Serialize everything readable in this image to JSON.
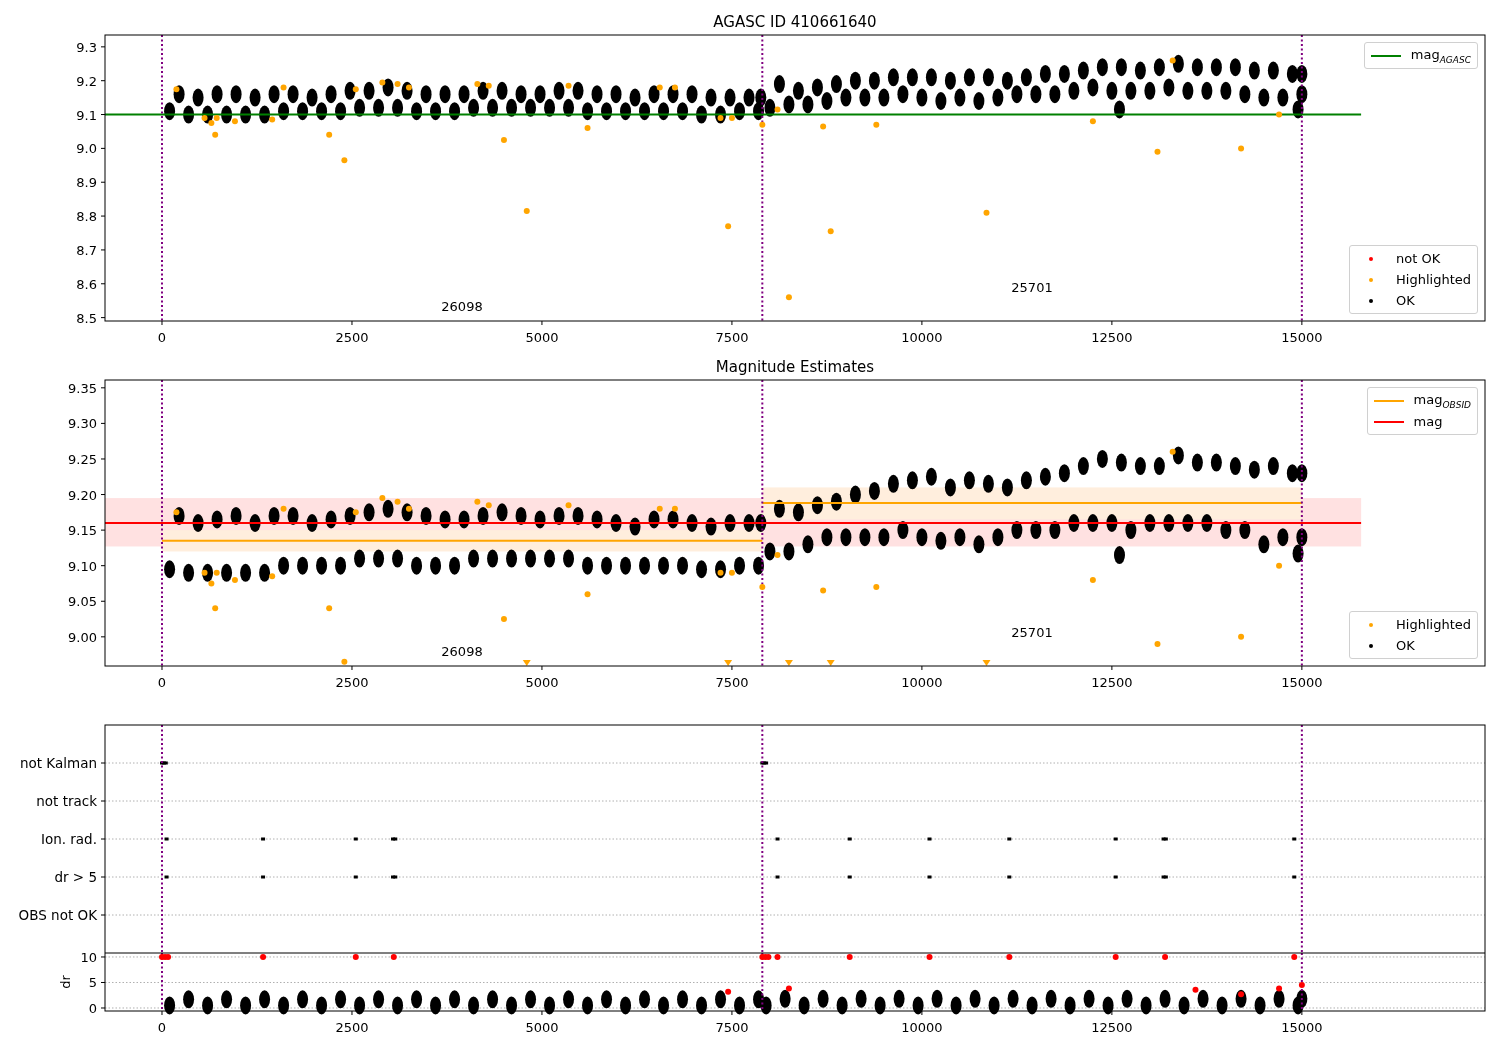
{
  "panels": [
    {
      "kind": "main",
      "legends": [
        {
          "items": [
            {
              "label": "mag$_{AGASC}$",
              "kind": "line",
              "color": "#008000"
            }
          ]
        },
        {
          "items": [
            {
              "label": "not OK",
              "kind": "marker",
              "color": "#ff0000"
            },
            {
              "label": "Highlighted",
              "kind": "marker",
              "color": "#ffa500"
            },
            {
              "label": "OK",
              "kind": "marker",
              "color": "#000000"
            }
          ]
        }
      ],
      "chart_data": {
        "type": "scatter",
        "title": "AGASC ID 410661640",
        "xlim": [
          -750,
          17410
        ],
        "ylim": [
          8.49,
          9.335
        ],
        "xticks": [
          0,
          2500,
          5000,
          7500,
          10000,
          12500,
          15000
        ],
        "yticks": [
          {
            "value": 8.5,
            "label": "8.5"
          },
          {
            "value": 8.6,
            "label": "8.6"
          },
          {
            "value": 8.7,
            "label": "8.7"
          },
          {
            "value": 8.8,
            "label": "8.8"
          },
          {
            "value": 8.9,
            "label": "8.9"
          },
          {
            "value": 9.0,
            "label": "9.0"
          },
          {
            "value": 9.1,
            "label": "9.1"
          },
          {
            "value": 9.2,
            "label": "9.2"
          },
          {
            "value": 9.3,
            "label": "9.3"
          }
        ],
        "series": [
          {
            "color": "#000000",
            "x": [
              100,
              225,
              350,
              475,
              600,
              725,
              850,
              975,
              1100,
              1225,
              1350,
              1475,
              1600,
              1725,
              1850,
              1975,
              2100,
              2225,
              2350,
              2475,
              2600,
              2725,
              2850,
              2975,
              3100,
              3225,
              3350,
              3475,
              3600,
              3725,
              3850,
              3975,
              4100,
              4225,
              4350,
              4475,
              4600,
              4725,
              4850,
              4975,
              5100,
              5225,
              5350,
              5475,
              5600,
              5725,
              5850,
              5975,
              6100,
              6225,
              6350,
              6475,
              6600,
              6725,
              6850,
              6975,
              7100,
              7225,
              7350,
              7475,
              7600,
              7725,
              7850,
              7880,
              8000,
              8125,
              8250,
              8375,
              8500,
              8625,
              8750,
              8875,
              9000,
              9125,
              9250,
              9375,
              9500,
              9625,
              9750,
              9875,
              10000,
              10125,
              10250,
              10375,
              10500,
              10625,
              10750,
              10875,
              11000,
              11125,
              11250,
              11375,
              11500,
              11625,
              11750,
              11875,
              12000,
              12125,
              12250,
              12375,
              12500,
              12625,
              12750,
              12875,
              13000,
              13125,
              13250,
              13375,
              13500,
              13625,
              13750,
              13875,
              14000,
              14125,
              14250,
              14375,
              14500,
              14625,
              14750,
              14875,
              15000,
              15000,
              12600,
              14950
            ],
            "values": [
              9.11,
              9.16,
              9.1,
              9.15,
              9.1,
              9.16,
              9.1,
              9.16,
              9.1,
              9.15,
              9.1,
              9.16,
              9.11,
              9.16,
              9.11,
              9.15,
              9.11,
              9.16,
              9.11,
              9.17,
              9.12,
              9.17,
              9.12,
              9.18,
              9.12,
              9.17,
              9.11,
              9.16,
              9.11,
              9.16,
              9.11,
              9.16,
              9.12,
              9.17,
              9.12,
              9.17,
              9.12,
              9.16,
              9.12,
              9.16,
              9.12,
              9.17,
              9.12,
              9.17,
              9.11,
              9.16,
              9.11,
              9.16,
              9.11,
              9.15,
              9.11,
              9.16,
              9.11,
              9.16,
              9.11,
              9.16,
              9.1,
              9.15,
              9.1,
              9.15,
              9.11,
              9.15,
              9.11,
              9.15,
              9.12,
              9.19,
              9.13,
              9.17,
              9.13,
              9.18,
              9.14,
              9.19,
              9.15,
              9.2,
              9.15,
              9.2,
              9.15,
              9.21,
              9.16,
              9.21,
              9.15,
              9.21,
              9.14,
              9.2,
              9.15,
              9.21,
              9.14,
              9.21,
              9.15,
              9.2,
              9.16,
              9.21,
              9.16,
              9.22,
              9.16,
              9.22,
              9.17,
              9.23,
              9.18,
              9.24,
              9.17,
              9.24,
              9.17,
              9.23,
              9.17,
              9.24,
              9.18,
              9.25,
              9.17,
              9.24,
              9.17,
              9.24,
              9.17,
              9.24,
              9.16,
              9.23,
              9.15,
              9.23,
              9.15,
              9.22,
              9.16,
              9.22,
              9.115,
              9.115
            ]
          },
          {
            "color": "#ffa500",
            "x": [
              190,
              560,
              650,
              700,
              720,
              960,
              1450,
              1600,
              2200,
              2400,
              2550,
              2900,
              3100,
              3250,
              4150,
              4300,
              4500,
              4800,
              5350,
              5600,
              6550,
              6750,
              7350,
              7450,
              7500,
              7900,
              8100,
              8250,
              8700,
              8800,
              9400,
              10850,
              12250,
              13100,
              13300,
              14200,
              14700
            ],
            "values": [
              9.175,
              9.09,
              9.075,
              9.04,
              9.09,
              9.08,
              9.085,
              9.18,
              9.04,
              8.965,
              9.175,
              9.195,
              9.19,
              9.18,
              9.19,
              9.185,
              9.025,
              8.815,
              9.185,
              9.06,
              9.18,
              9.18,
              9.09,
              8.77,
              9.09,
              9.07,
              9.115,
              8.56,
              9.065,
              8.755,
              9.07,
              8.81,
              9.08,
              8.99,
              9.26,
              9.0,
              9.1
            ]
          },
          {
            "type": "line",
            "color": "#008000",
            "x": [
              -750,
              15780
            ],
            "values": [
              9.1,
              9.1
            ]
          }
        ],
        "ref_lines": [
          {
            "axis": "x",
            "value": 0,
            "color": "#800080"
          },
          {
            "axis": "x",
            "value": 7900,
            "color": "#800080"
          },
          {
            "axis": "x",
            "value": 15000,
            "color": "#800080"
          }
        ],
        "annotations": [
          "26098",
          "25701"
        ]
      }
    },
    {
      "kind": "main",
      "legends": [
        {
          "items": [
            {
              "label": "mag$_{OBSID}$",
              "kind": "line",
              "color": "#ffa500"
            },
            {
              "label": "mag",
              "kind": "line",
              "color": "#ff0000"
            }
          ]
        },
        {
          "items": [
            {
              "label": "Highlighted",
              "kind": "marker",
              "color": "#ffa500"
            },
            {
              "label": "OK",
              "kind": "marker",
              "color": "#000000"
            }
          ]
        }
      ],
      "chart_data": {
        "type": "scatter",
        "title": "Magnitude Estimates",
        "xlim": [
          -750,
          17410
        ],
        "ylim": [
          8.959,
          9.361
        ],
        "xticks": [
          0,
          2500,
          5000,
          7500,
          10000,
          12500,
          15000
        ],
        "yticks": [
          {
            "value": 9.0,
            "label": "9.00"
          },
          {
            "value": 9.05,
            "label": "9.05"
          },
          {
            "value": 9.1,
            "label": "9.10"
          },
          {
            "value": 9.15,
            "label": "9.15"
          },
          {
            "value": 9.2,
            "label": "9.20"
          },
          {
            "value": 9.25,
            "label": "9.25"
          },
          {
            "value": 9.3,
            "label": "9.30"
          },
          {
            "value": 9.35,
            "label": "9.35"
          }
        ],
        "bands": [
          {
            "axis": "y",
            "from": 9.127,
            "to": 9.195,
            "color": "#ffe1e1"
          },
          {
            "axis": "y",
            "from": 9.12,
            "to": 9.15,
            "color": "#ffeedd"
          },
          {
            "axis": "y",
            "from": 9.165,
            "to": 9.21,
            "color": "#ffeedd"
          }
        ],
        "series": [
          {
            "color": "#000000",
            "x": [
              100,
              225,
              350,
              475,
              600,
              725,
              850,
              975,
              1100,
              1225,
              1350,
              1475,
              1600,
              1725,
              1850,
              1975,
              2100,
              2225,
              2350,
              2475,
              2600,
              2725,
              2850,
              2975,
              3100,
              3225,
              3350,
              3475,
              3600,
              3725,
              3850,
              3975,
              4100,
              4225,
              4350,
              4475,
              4600,
              4725,
              4850,
              4975,
              5100,
              5225,
              5350,
              5475,
              5600,
              5725,
              5850,
              5975,
              6100,
              6225,
              6350,
              6475,
              6600,
              6725,
              6850,
              6975,
              7100,
              7225,
              7350,
              7475,
              7600,
              7725,
              7850,
              7880,
              8000,
              8125,
              8250,
              8375,
              8500,
              8625,
              8750,
              8875,
              9000,
              9125,
              9250,
              9375,
              9500,
              9625,
              9750,
              9875,
              10000,
              10125,
              10250,
              10375,
              10500,
              10625,
              10750,
              10875,
              11000,
              11125,
              11250,
              11375,
              11500,
              11625,
              11750,
              11875,
              12000,
              12125,
              12250,
              12375,
              12500,
              12625,
              12750,
              12875,
              13000,
              13125,
              13250,
              13375,
              13500,
              13625,
              13750,
              13875,
              14000,
              14125,
              14250,
              14375,
              14500,
              14625,
              14750,
              14875,
              15000,
              15000,
              12600,
              14950
            ],
            "values": [
              9.095,
              9.17,
              9.09,
              9.16,
              9.09,
              9.165,
              9.09,
              9.17,
              9.09,
              9.16,
              9.09,
              9.17,
              9.1,
              9.17,
              9.1,
              9.16,
              9.1,
              9.165,
              9.1,
              9.17,
              9.11,
              9.175,
              9.11,
              9.18,
              9.11,
              9.175,
              9.1,
              9.17,
              9.1,
              9.165,
              9.1,
              9.165,
              9.11,
              9.17,
              9.11,
              9.175,
              9.11,
              9.17,
              9.11,
              9.165,
              9.11,
              9.17,
              9.11,
              9.17,
              9.1,
              9.165,
              9.1,
              9.16,
              9.1,
              9.155,
              9.1,
              9.165,
              9.1,
              9.165,
              9.1,
              9.16,
              9.095,
              9.155,
              9.095,
              9.16,
              9.1,
              9.16,
              9.1,
              9.16,
              9.12,
              9.18,
              9.12,
              9.175,
              9.13,
              9.185,
              9.14,
              9.19,
              9.14,
              9.2,
              9.14,
              9.205,
              9.14,
              9.215,
              9.15,
              9.22,
              9.14,
              9.225,
              9.135,
              9.21,
              9.14,
              9.22,
              9.13,
              9.215,
              9.14,
              9.21,
              9.15,
              9.22,
              9.15,
              9.225,
              9.15,
              9.23,
              9.16,
              9.24,
              9.16,
              9.25,
              9.16,
              9.245,
              9.15,
              9.24,
              9.16,
              9.24,
              9.16,
              9.255,
              9.16,
              9.245,
              9.16,
              9.245,
              9.15,
              9.24,
              9.15,
              9.235,
              9.13,
              9.24,
              9.14,
              9.23,
              9.14,
              9.23,
              9.115,
              9.117
            ]
          },
          {
            "color": "#ffa500",
            "x": [
              190,
              560,
              650,
              700,
              720,
              960,
              1450,
              1600,
              2200,
              2400,
              2550,
              2900,
              3100,
              3250,
              4150,
              4300,
              4500,
              4800,
              5350,
              5600,
              6550,
              6750,
              7350,
              7450,
              7500,
              7900,
              8100,
              8250,
              8700,
              8800,
              9400,
              10850,
              12250,
              13100,
              13300,
              14200,
              14700
            ],
            "values": [
              9.175,
              9.09,
              9.075,
              9.04,
              9.09,
              9.08,
              9.085,
              9.18,
              9.04,
              8.965,
              9.175,
              9.195,
              9.19,
              9.18,
              9.19,
              9.185,
              9.025,
              null,
              9.185,
              9.06,
              9.18,
              9.18,
              9.09,
              null,
              9.09,
              9.07,
              9.115,
              null,
              9.065,
              null,
              9.07,
              null,
              9.08,
              8.99,
              9.26,
              9.0,
              9.1
            ]
          },
          {
            "color": "#ffa500",
            "x": [
              4800,
              7450,
              8250,
              8800,
              10850
            ],
            "values": [
              8.963,
              8.963,
              8.963,
              8.963,
              8.963
            ]
          },
          {
            "type": "line",
            "color": "#ff0000",
            "x": [
              -750,
              15780
            ],
            "values": [
              9.16,
              9.16
            ]
          },
          {
            "type": "line",
            "color": "#ffa500",
            "x": [
              0,
              7900
            ],
            "values": [
              9.135,
              9.135
            ]
          },
          {
            "type": "line",
            "color": "#ffa500",
            "x": [
              7900,
              15000
            ],
            "values": [
              9.188,
              9.188
            ]
          }
        ],
        "ref_lines": [
          {
            "axis": "x",
            "value": 0,
            "color": "#800080"
          },
          {
            "axis": "x",
            "value": 7900,
            "color": "#800080"
          },
          {
            "axis": "x",
            "value": 15000,
            "color": "#800080"
          }
        ],
        "annotations": [
          "26098",
          "25701"
        ]
      }
    },
    {
      "kind": "flags",
      "rows": [
        "not Kalman",
        "not track",
        "Ion. rad.",
        "dr > 5",
        "OBS not OK"
      ]
    },
    {
      "kind": "dr",
      "chart_data": {
        "type": "scatter",
        "ylabel": "dr",
        "grid": true,
        "xlim": [
          -750,
          17410
        ],
        "ylim": [
          -0.59,
          10.78
        ],
        "xticks": [
          0,
          2500,
          5000,
          7500,
          10000,
          12500,
          15000
        ],
        "yticks": [
          {
            "value": 0,
            "label": "0"
          },
          {
            "value": 5,
            "label": "5"
          },
          {
            "value": 10,
            "label": "10"
          }
        ],
        "series": [
          {
            "color": "#000000",
            "x": [
              100,
              350,
              600,
              850,
              1100,
              1350,
              1600,
              1850,
              2100,
              2350,
              2600,
              2850,
              3100,
              3350,
              3600,
              3850,
              4100,
              4350,
              4600,
              4850,
              5100,
              5350,
              5600,
              5850,
              6100,
              6350,
              6600,
              6850,
              7100,
              7350,
              7600,
              7850,
              7950,
              8200,
              8450,
              8700,
              8950,
              9200,
              9450,
              9700,
              9950,
              10200,
              10450,
              10700,
              10950,
              11200,
              11450,
              11700,
              11950,
              12200,
              12450,
              12700,
              12950,
              13200,
              13450,
              13700,
              13950,
              14200,
              14450,
              14700,
              14950,
              15000
            ],
            "values": [
              0.5,
              1.7,
              0.5,
              1.7,
              0.5,
              1.7,
              0.5,
              1.7,
              0.5,
              1.7,
              0.5,
              1.7,
              0.5,
              1.7,
              0.5,
              1.7,
              0.5,
              1.7,
              0.5,
              1.7,
              0.5,
              1.7,
              0.5,
              1.7,
              0.5,
              1.7,
              0.5,
              1.7,
              0.5,
              1.7,
              0.5,
              1.7,
              0.5,
              1.8,
              0.5,
              1.8,
              0.5,
              1.8,
              0.5,
              1.8,
              0.5,
              1.8,
              0.5,
              1.8,
              0.5,
              1.8,
              0.5,
              1.8,
              0.5,
              1.8,
              0.5,
              1.8,
              0.5,
              1.8,
              0.5,
              1.8,
              0.5,
              1.8,
              0.5,
              1.8,
              0.5,
              1.8
            ]
          },
          {
            "color": "#ff0000",
            "x": [
              0,
              40,
              80,
              1330,
              2550,
              3050,
              7450,
              7900,
              7940,
              7980,
              8100,
              8250,
              9050,
              10100,
              11150,
              12550,
              13200,
              13600,
              14200,
              14700,
              14900,
              15000
            ],
            "values": [
              10,
              10,
              10,
              10,
              10,
              10,
              3.2,
              10,
              10,
              10,
              10,
              3.8,
              10,
              10,
              10,
              10,
              10,
              3.6,
              2.7,
              3.8,
              10,
              4.5
            ]
          }
        ],
        "ref_lines": [
          {
            "axis": "x",
            "value": 0,
            "color": "#800080"
          },
          {
            "axis": "x",
            "value": 7900,
            "color": "#800080"
          },
          {
            "axis": "x",
            "value": 15000,
            "color": "#800080"
          }
        ]
      }
    }
  ]
}
